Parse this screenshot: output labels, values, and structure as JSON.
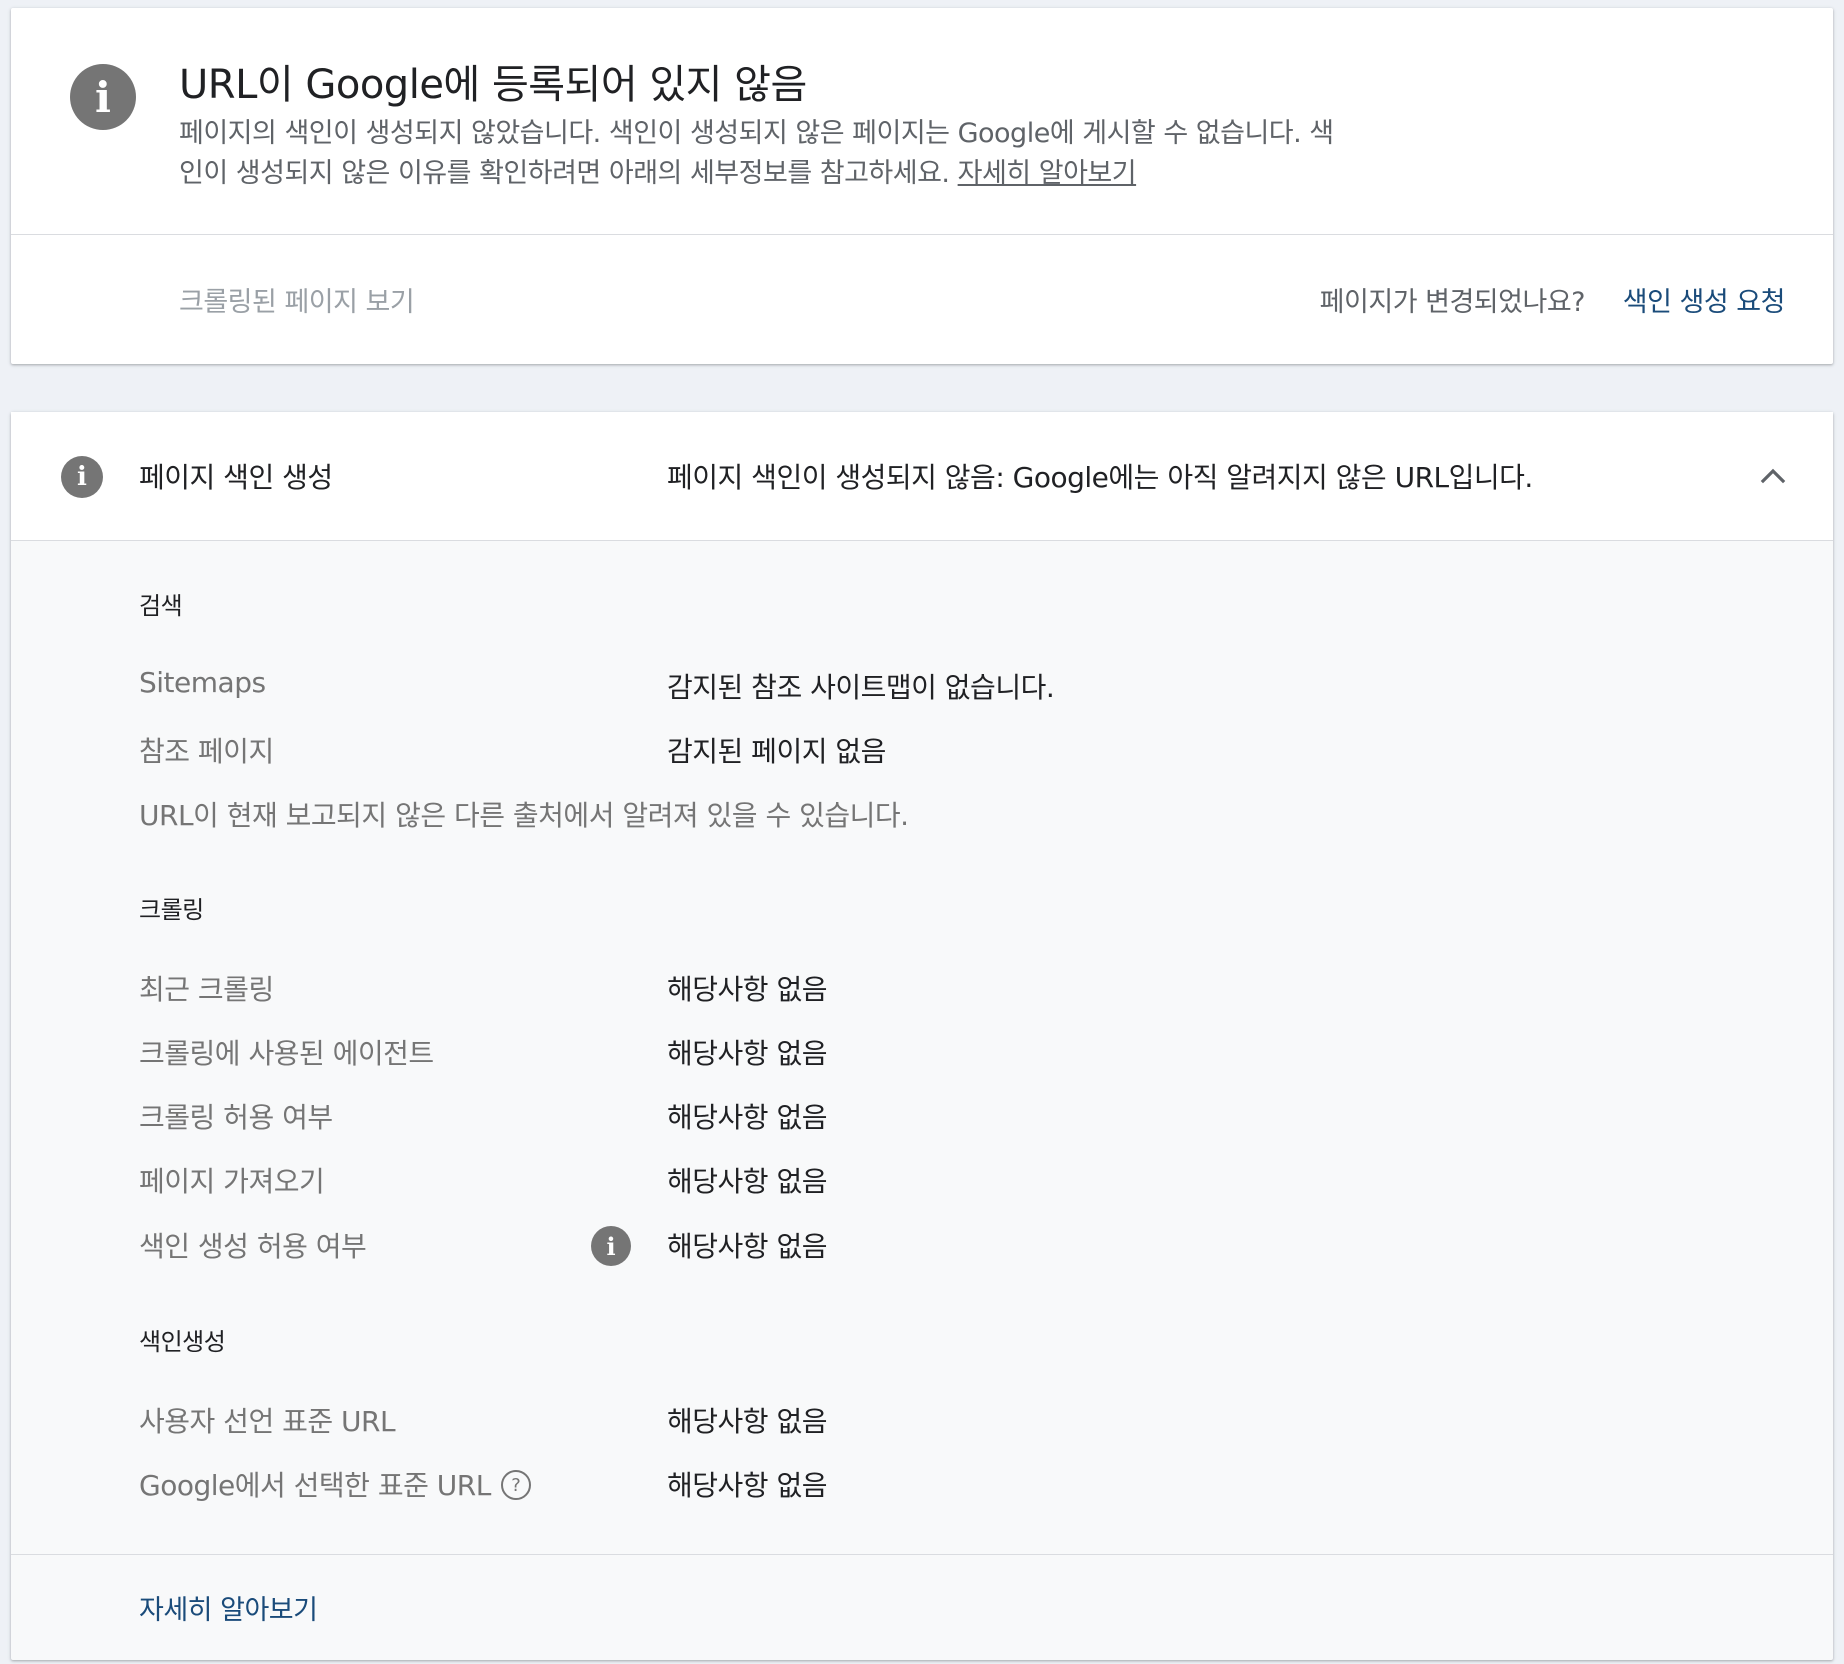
{
  "status": {
    "icon": "info-icon",
    "title": "URL이 Google에 등록되어 있지 않음",
    "description": "페이지의 색인이 생성되지 않았습니다. 색인이 생성되지 않은 페이지는 Google에 게시할 수 없습니다. 색인이 생성되지 않은 이유를 확인하려면 아래의 세부정보를 참고하세요.",
    "learn_more_link": "자세히 알아보기",
    "view_crawled_page": "크롤링된 페이지 보기",
    "page_changed_question": "페이지가 변경되었나요?",
    "request_indexing": "색인 생성 요청"
  },
  "indexing": {
    "header_icon": "info-icon",
    "header_label": "페이지 색인 생성",
    "header_value": "페이지 색인이 생성되지 않음: Google에는 아직 알려지지 않은 URL입니다.",
    "collapse_icon": "chevron-up-icon",
    "discovery": {
      "heading": "검색",
      "rows": [
        {
          "label": "Sitemaps",
          "value": "감지된 참조 사이트맵이 없습니다."
        },
        {
          "label": "참조 페이지",
          "value": "감지된 페이지 없음"
        }
      ],
      "note": "URL이 현재 보고되지 않은 다른 출처에서 알려져 있을 수 있습니다."
    },
    "crawl": {
      "heading": "크롤링",
      "rows": [
        {
          "label": "최근 크롤링",
          "value": "해당사항 없음"
        },
        {
          "label": "크롤링에 사용된 에이전트",
          "value": "해당사항 없음"
        },
        {
          "label": "크롤링 허용 여부",
          "value": "해당사항 없음"
        },
        {
          "label": "페이지 가져오기",
          "value": "해당사항 없음"
        },
        {
          "label": "색인 생성 허용 여부",
          "value": "해당사항 없음",
          "icon": "info-icon"
        }
      ]
    },
    "index": {
      "heading": "색인생성",
      "rows": [
        {
          "label": "사용자 선언 표준 URL",
          "value": "해당사항 없음"
        },
        {
          "label": "Google에서 선택한 표준 URL",
          "value": "해당사항 없음",
          "icon": "help-icon",
          "icon_glyph": "?"
        }
      ]
    },
    "learn_more": "자세히 알아보기"
  },
  "colors": {
    "background": "#eef1f6",
    "card": "#ffffff",
    "detail_bg": "#f8f9fa",
    "icon_grey": "#757575",
    "link_blue": "#1a4b7a",
    "muted_text": "#5f6368",
    "disabled_text": "#9aa0a6"
  }
}
